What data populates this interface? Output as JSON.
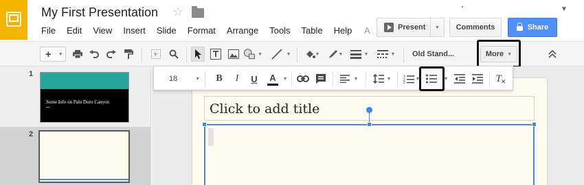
{
  "header": {
    "doc_title": "My First Presentation",
    "star_icon": "star-icon",
    "folder_icon": "folder-icon"
  },
  "menu": [
    "File",
    "Edit",
    "View",
    "Insert",
    "Slide",
    "Format",
    "Arrange",
    "Tools",
    "Table",
    "Help"
  ],
  "menu_overflow": "A",
  "actions": {
    "present": "Present",
    "comments": "Comments",
    "share": "Share"
  },
  "toolbar": {
    "add": "+",
    "theme": "Old Stand...",
    "more": "More"
  },
  "format_toolbar": {
    "font_size": "18",
    "bold": "B",
    "italic": "I",
    "underline": "U",
    "text_color": "A",
    "clear_format": "T"
  },
  "slides": [
    {
      "number": "1",
      "title": "Some Info on Palo Duro Canyon"
    },
    {
      "number": "2"
    }
  ],
  "editor": {
    "title_placeholder": "Click to add title"
  },
  "colors": {
    "logo": "#f4b400",
    "share": "#4d90fe",
    "selection": "#4285f4",
    "slide_bg": "#fefbf0",
    "thumb_band": "#26a69a"
  }
}
